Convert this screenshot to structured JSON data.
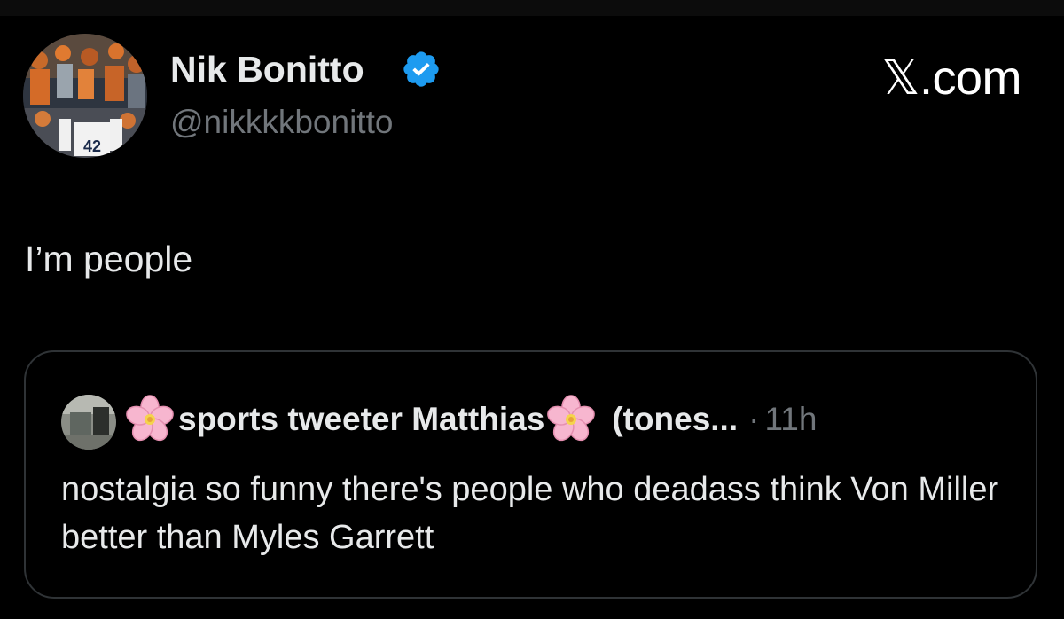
{
  "tweet": {
    "author_name": "Nik Bonitto",
    "author_handle": "@nikkkkbonitto",
    "text": "I’m people",
    "avatar_jersey_number": "42"
  },
  "brand": {
    "logo_text": "𝕏.com"
  },
  "quoted_tweet": {
    "author_name": "sports tweeter Matthias",
    "author_name_suffix": "(tones...",
    "separator": "·",
    "timestamp": "11h",
    "text": "nostalgia so funny there's people who deadass think Von Miller better than Myles Garrett"
  },
  "icons": {
    "verified": "verified-badge-icon",
    "flower": "cherry-blossom-icon"
  },
  "colors": {
    "background": "#000000",
    "primary_text": "#e7e9ea",
    "secondary_text": "#71767b",
    "verified_blue": "#1d9bf0",
    "card_border": "#2f3336",
    "blossom_pink": "#f7b6cf"
  }
}
